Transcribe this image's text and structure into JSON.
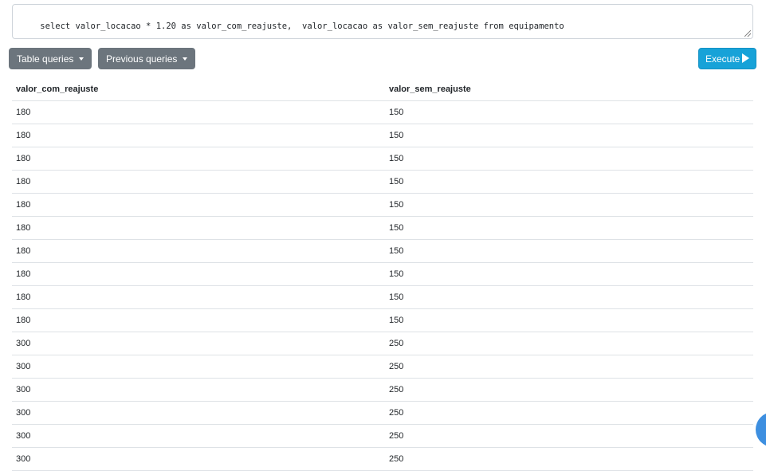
{
  "query": {
    "text": "select valor_locacao * 1.20 as valor_com_reajuste,  valor_locacao as valor_sem_reajuste from equipamento"
  },
  "toolbar": {
    "table_queries_label": "Table queries",
    "previous_queries_label": "Previous queries",
    "execute_label": "Execute"
  },
  "colors": {
    "secondary": "#6c757d",
    "execute": "#17a2d8",
    "fab": "#3d8fe0"
  },
  "results": {
    "columns": [
      "valor_com_reajuste",
      "valor_sem_reajuste"
    ],
    "rows": [
      [
        "180",
        "150"
      ],
      [
        "180",
        "150"
      ],
      [
        "180",
        "150"
      ],
      [
        "180",
        "150"
      ],
      [
        "180",
        "150"
      ],
      [
        "180",
        "150"
      ],
      [
        "180",
        "150"
      ],
      [
        "180",
        "150"
      ],
      [
        "180",
        "150"
      ],
      [
        "180",
        "150"
      ],
      [
        "300",
        "250"
      ],
      [
        "300",
        "250"
      ],
      [
        "300",
        "250"
      ],
      [
        "300",
        "250"
      ],
      [
        "300",
        "250"
      ],
      [
        "300",
        "250"
      ]
    ]
  }
}
